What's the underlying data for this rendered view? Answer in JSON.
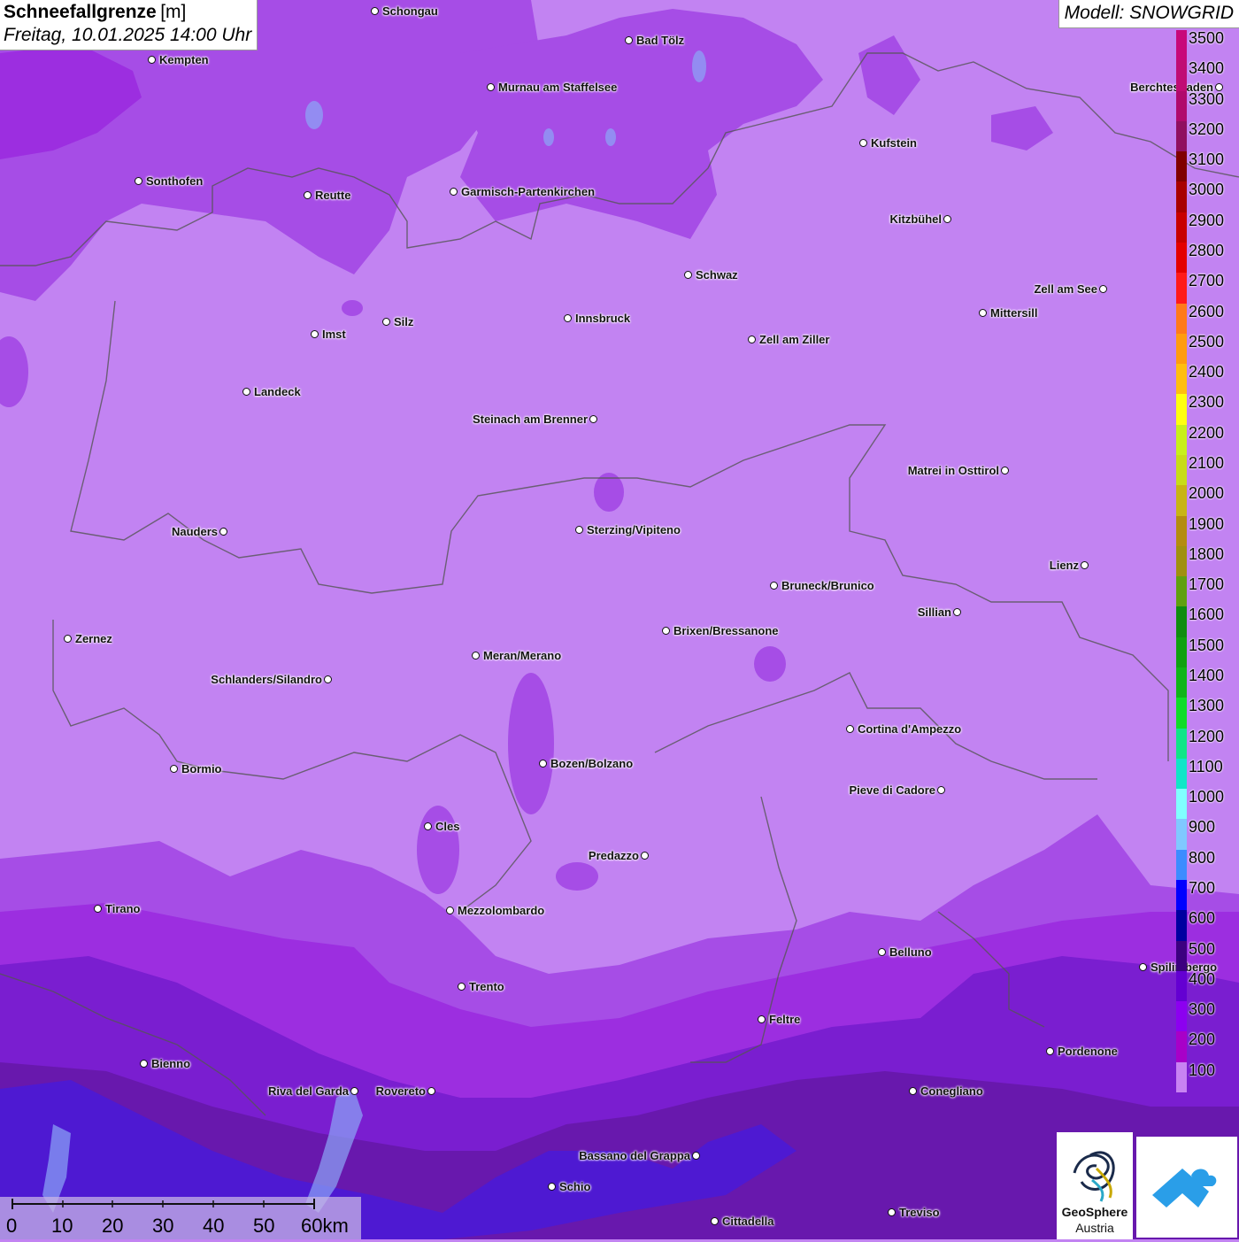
{
  "header": {
    "title": "Schneefallgrenze",
    "unit": "[m]",
    "datetime": "Freitag, 10.01.2025 14:00 Uhr",
    "model": "Modell: SNOWGRID"
  },
  "cities": [
    {
      "name": "Schongau",
      "label_side": "right"
    },
    {
      "name": "Bad Tölz",
      "label_side": "right"
    },
    {
      "name": "Kempten",
      "label_side": "right"
    },
    {
      "name": "Murnau am Staffelsee",
      "label_side": "right"
    },
    {
      "name": "Berchtesgaden",
      "label_side": "left"
    },
    {
      "name": "Kufstein",
      "label_side": "right"
    },
    {
      "name": "Sonthofen",
      "label_side": "right"
    },
    {
      "name": "Reutte",
      "label_side": "right"
    },
    {
      "name": "Garmisch-Partenkirchen",
      "label_side": "right"
    },
    {
      "name": "Kitzbühel",
      "label_side": "left"
    },
    {
      "name": "Schwaz",
      "label_side": "right"
    },
    {
      "name": "Zell am See",
      "label_side": "left"
    },
    {
      "name": "Innsbruck",
      "label_side": "right"
    },
    {
      "name": "Mittersill",
      "label_side": "right"
    },
    {
      "name": "Imst",
      "label_side": "right"
    },
    {
      "name": "Silz",
      "label_side": "right"
    },
    {
      "name": "Zell am Ziller",
      "label_side": "right"
    },
    {
      "name": "Landeck",
      "label_side": "right"
    },
    {
      "name": "Steinach am Brenner",
      "label_side": "left"
    },
    {
      "name": "Matrei in Osttirol",
      "label_side": "left"
    },
    {
      "name": "Nauders",
      "label_side": "left"
    },
    {
      "name": "Sterzing/Vipiteno",
      "label_side": "right"
    },
    {
      "name": "Lienz",
      "label_side": "left"
    },
    {
      "name": "Bruneck/Brunico",
      "label_side": "right"
    },
    {
      "name": "Sillian",
      "label_side": "left"
    },
    {
      "name": "Zernez",
      "label_side": "right"
    },
    {
      "name": "Brixen/Bressanone",
      "label_side": "right"
    },
    {
      "name": "Meran/Merano",
      "label_side": "right"
    },
    {
      "name": "Schlanders/Silandro",
      "label_side": "left"
    },
    {
      "name": "Cortina d'Ampezzo",
      "label_side": "right"
    },
    {
      "name": "Bormio",
      "label_side": "right"
    },
    {
      "name": "Bozen/Bolzano",
      "label_side": "right"
    },
    {
      "name": "Pieve di Cadore",
      "label_side": "left"
    },
    {
      "name": "Cles",
      "label_side": "right"
    },
    {
      "name": "Predazzo",
      "label_side": "left"
    },
    {
      "name": "Tirano",
      "label_side": "right"
    },
    {
      "name": "Mezzolombardo",
      "label_side": "right"
    },
    {
      "name": "Belluno",
      "label_side": "right"
    },
    {
      "name": "Spilimbergo",
      "label_side": "right"
    },
    {
      "name": "Trento",
      "label_side": "right"
    },
    {
      "name": "Feltre",
      "label_side": "right"
    },
    {
      "name": "Pordenone",
      "label_side": "right"
    },
    {
      "name": "Bienno",
      "label_side": "right"
    },
    {
      "name": "Riva del Garda",
      "label_side": "left"
    },
    {
      "name": "Rovereto",
      "label_side": "left"
    },
    {
      "name": "Conegliano",
      "label_side": "right"
    },
    {
      "name": "Bassano del Grappa",
      "label_side": "left"
    },
    {
      "name": "Schio",
      "label_side": "right"
    },
    {
      "name": "Treviso",
      "label_side": "right"
    },
    {
      "name": "Cittadella",
      "label_side": "right"
    }
  ],
  "legend": {
    "levels": [
      {
        "label": "3500",
        "color": "#c8087a"
      },
      {
        "label": "3400",
        "color": "#c00c74"
      },
      {
        "label": "3300",
        "color": "#b00a6c"
      },
      {
        "label": "3200",
        "color": "#901060"
      },
      {
        "label": "3100",
        "color": "#800000"
      },
      {
        "label": "3000",
        "color": "#a80000"
      },
      {
        "label": "2900",
        "color": "#c80000"
      },
      {
        "label": "2800",
        "color": "#e40000"
      },
      {
        "label": "2700",
        "color": "#ff1a1a"
      },
      {
        "label": "2600",
        "color": "#ff7a1a"
      },
      {
        "label": "2500",
        "color": "#ff9c10"
      },
      {
        "label": "2400",
        "color": "#ffbe10"
      },
      {
        "label": "2300",
        "color": "#ffff10"
      },
      {
        "label": "2200",
        "color": "#c8f01a"
      },
      {
        "label": "2100",
        "color": "#c8dc18"
      },
      {
        "label": "2000",
        "color": "#c8b414"
      },
      {
        "label": "1900",
        "color": "#b48c10"
      },
      {
        "label": "1800",
        "color": "#a09010"
      },
      {
        "label": "1700",
        "color": "#60a010"
      },
      {
        "label": "1600",
        "color": "#108c10"
      },
      {
        "label": "1500",
        "color": "#10a010"
      },
      {
        "label": "1400",
        "color": "#10b418"
      },
      {
        "label": "1300",
        "color": "#10dc28"
      },
      {
        "label": "1200",
        "color": "#10e688"
      },
      {
        "label": "1100",
        "color": "#10e6c8"
      },
      {
        "label": "1000",
        "color": "#80ffff"
      },
      {
        "label": "900",
        "color": "#80c8ff"
      },
      {
        "label": "800",
        "color": "#3c8cff"
      },
      {
        "label": "700",
        "color": "#0000ff"
      },
      {
        "label": "600",
        "color": "#0000a0"
      },
      {
        "label": "500",
        "color": "#3c0080"
      },
      {
        "label": "400",
        "color": "#6400d2"
      },
      {
        "label": "300",
        "color": "#8c00f0"
      },
      {
        "label": "200",
        "color": "#a800c8"
      },
      {
        "label": "100",
        "color": "#c883f2"
      }
    ]
  },
  "scalebar": {
    "ticks": [
      "0",
      "10",
      "20",
      "30",
      "40",
      "50",
      "60km"
    ]
  },
  "logos": {
    "geosphere_line1": "GeoSphere",
    "geosphere_line2": "Austria"
  },
  "colors": {
    "base_100": "#c283f2",
    "band_300": "#a64de6",
    "band_200": "#9c2ee0",
    "band_400": "#7a1ed0",
    "band_500": "#5a1490",
    "band_700": "#4a1ad8",
    "border_line": "#555555"
  }
}
